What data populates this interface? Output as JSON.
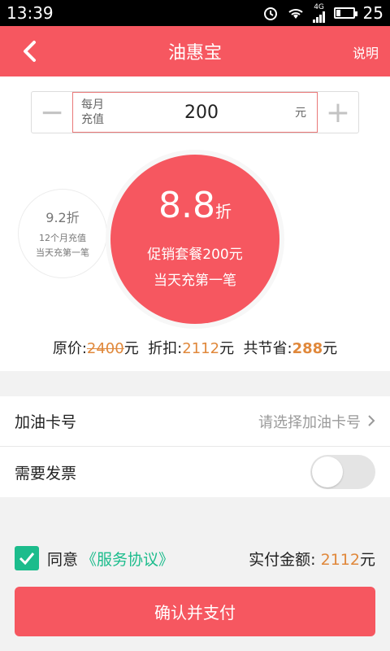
{
  "status_bar": {
    "time": "13:39",
    "signal": "4G",
    "battery": "25",
    "battery_level": 0.25
  },
  "nav": {
    "title": "油惠宝",
    "help_label": "说明"
  },
  "stepper": {
    "minus": "−",
    "label_line1": "每月",
    "label_line2": "充值",
    "value": "200",
    "unit": "元",
    "plus": "+"
  },
  "offer_small": {
    "rate": "9.2折",
    "line1": "12个月充值",
    "line2": "当天充第一笔"
  },
  "offer_big": {
    "rate_number": "8.8",
    "rate_suffix": "折",
    "line1": "促销套餐200元",
    "line2": "当天充第一笔"
  },
  "price": {
    "orig_label": "原价:",
    "orig_value": "2400",
    "orig_unit": "元",
    "discount_label": "折扣:",
    "discount_value": "2112",
    "discount_unit": "元",
    "save_label": "共节省:",
    "save_value": "288",
    "save_unit": "元"
  },
  "card_row": {
    "label": "加油卡号",
    "placeholder": "请选择加油卡号"
  },
  "invoice_row": {
    "label": "需要发票",
    "enabled": false
  },
  "agree": {
    "checked": true,
    "text": "同意",
    "link": "《服务协议》",
    "pay_label": "实付金额:",
    "pay_value": "2112",
    "pay_unit": "元"
  },
  "confirm_button": "确认并支付",
  "colors": {
    "primary": "#f65760",
    "accent_green": "#1cbc8c",
    "orange": "#e0883b"
  }
}
